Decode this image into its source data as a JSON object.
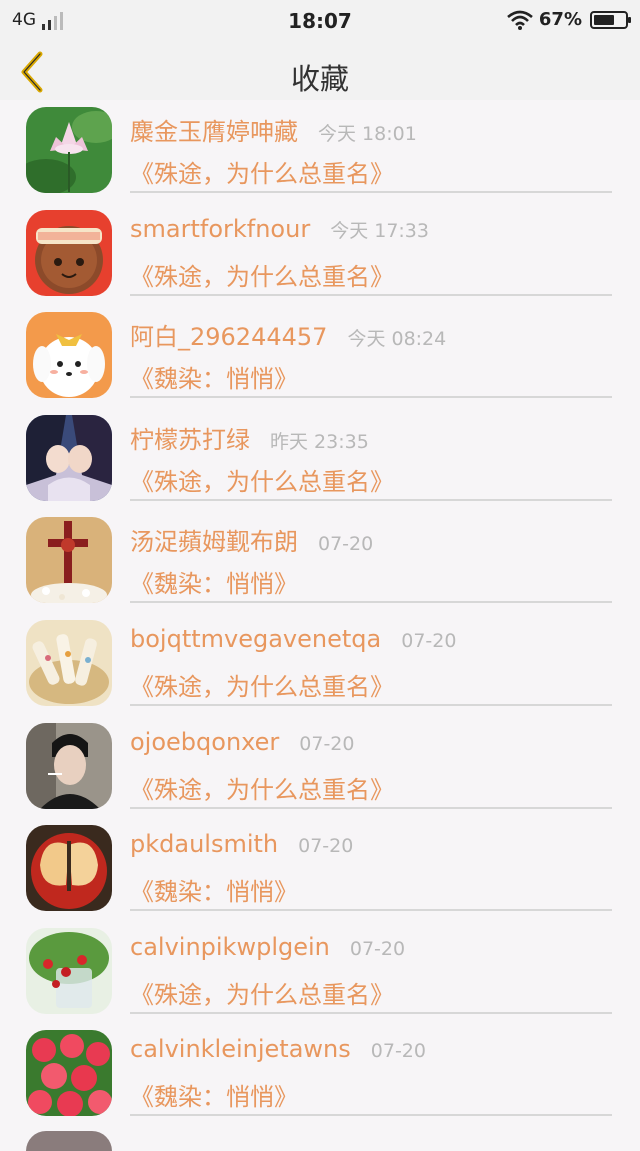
{
  "status_bar": {
    "network": "4G",
    "time": "18:07",
    "battery": "67%",
    "battery_level": 0.67
  },
  "header": {
    "back_icon": "chevron-left-icon",
    "title": "收藏"
  },
  "favorites": [
    {
      "name": "麋金玉膺婷呻藏",
      "time": "今天 18:01",
      "topic": "《殊途，为什么总重名》",
      "avatar": "lotus"
    },
    {
      "name": "smartforkfnour",
      "time": "今天 17:33",
      "topic": "《殊途，为什么总重名》",
      "avatar": "mooncake"
    },
    {
      "name": "阿白_296244457",
      "time": "今天 08:24",
      "topic": "《魏染：悄悄》",
      "avatar": "white-puppy"
    },
    {
      "name": "柠檬苏打绿",
      "time": "昨天 23:35",
      "topic": "《殊途，为什么总重名》",
      "avatar": "anime-couple"
    },
    {
      "name": "汤浞蘋姆觐布朗",
      "time": "07-20",
      "topic": "《魏染：悄悄》",
      "avatar": "cross"
    },
    {
      "name": "bojqttmvegavenetqa",
      "time": "07-20",
      "topic": "《殊途，为什么总重名》",
      "avatar": "snacks"
    },
    {
      "name": "ojoebqonxer",
      "time": "07-20",
      "topic": "《殊途，为什么总重名》",
      "avatar": "man-portrait"
    },
    {
      "name": "pkdaulsmith",
      "time": "07-20",
      "topic": "《魏染：悄悄》",
      "avatar": "apple-butterfly"
    },
    {
      "name": "calvinpikwplgein",
      "time": "07-20",
      "topic": "《殊途，为什么总重名》",
      "avatar": "strawberries"
    },
    {
      "name": "calvinkleinjetawns",
      "time": "07-20",
      "topic": "《魏染：悄悄》",
      "avatar": "pink-flowers"
    }
  ],
  "colors": {
    "accent": "#e8975e",
    "back_icon": "#d9a800",
    "muted": "#b8b8b8"
  }
}
